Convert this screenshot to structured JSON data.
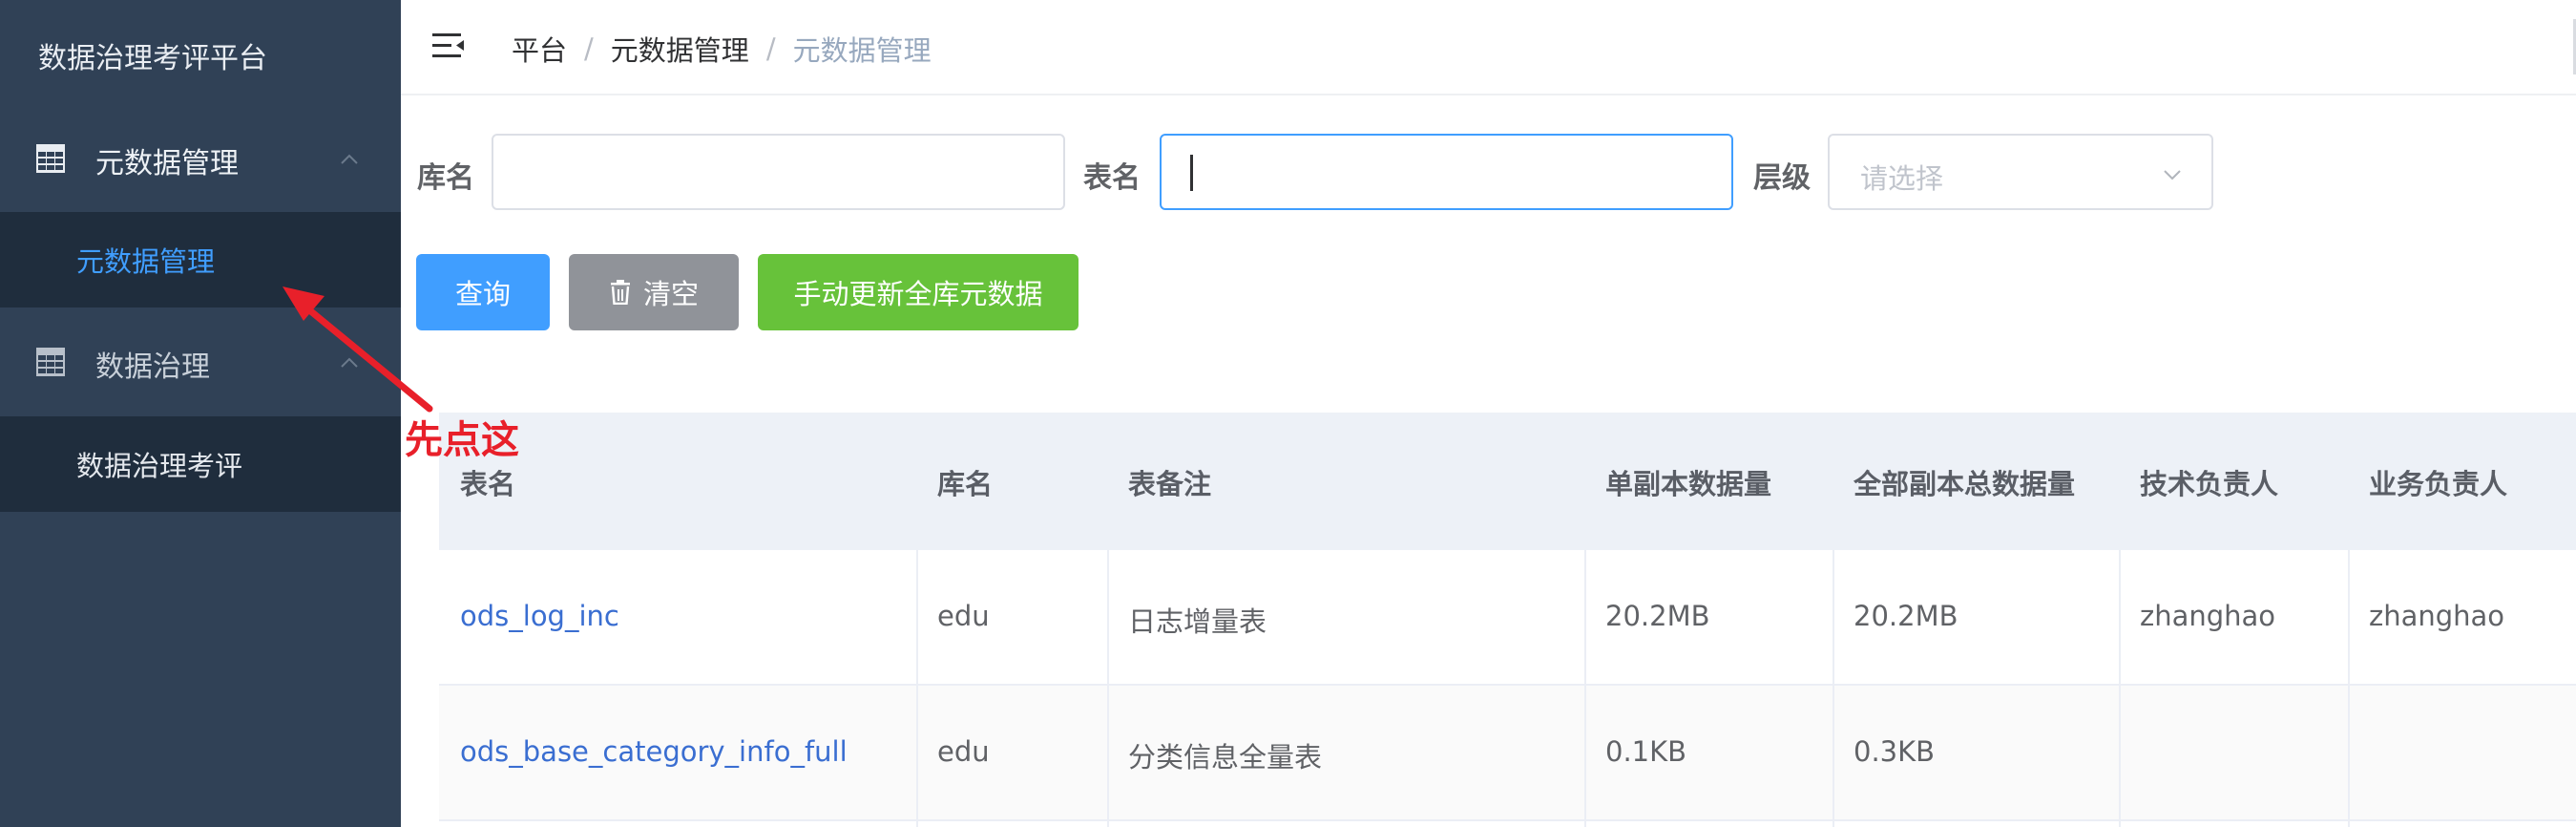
{
  "sidebar": {
    "logo": "数据治理考评平台",
    "menus": [
      {
        "label": "元数据管理",
        "icon": "table-grid-icon",
        "children": [
          "元数据管理"
        ]
      },
      {
        "label": "数据治理",
        "icon": "table-grid-icon",
        "children": [
          "数据治理考评"
        ]
      }
    ]
  },
  "header": {
    "menu_icon": "menu-fold-icon",
    "breadcrumb": [
      "平台",
      "元数据管理",
      "元数据管理"
    ],
    "separator": "/"
  },
  "search": {
    "db_label": "库名",
    "db_value": "",
    "table_label": "表名",
    "table_value": "",
    "level_label": "层级",
    "level_placeholder": "请选择"
  },
  "buttons": {
    "query": "查询",
    "clear": "清空",
    "update": "手动更新全库元数据"
  },
  "table": {
    "columns": [
      "表名",
      "库名",
      "表备注",
      "单副本数据量",
      "全部副本总数据量",
      "技术负责人",
      "业务负责人"
    ],
    "rows": [
      [
        "ods_log_inc",
        "edu",
        "日志增量表",
        "20.2MB",
        "20.2MB",
        "zhanghao",
        "zhanghao"
      ],
      [
        "ods_base_category_info_full",
        "edu",
        "分类信息全量表",
        "0.1KB",
        "0.3KB",
        "",
        ""
      ]
    ]
  },
  "annotation": {
    "text": "先点这",
    "color": "#e8202a"
  },
  "colors": {
    "sidebar_bg": "#304156",
    "submenu_bg": "#1f2d3d",
    "accent": "#409eff",
    "success": "#67c23a",
    "neutral": "#909399"
  }
}
